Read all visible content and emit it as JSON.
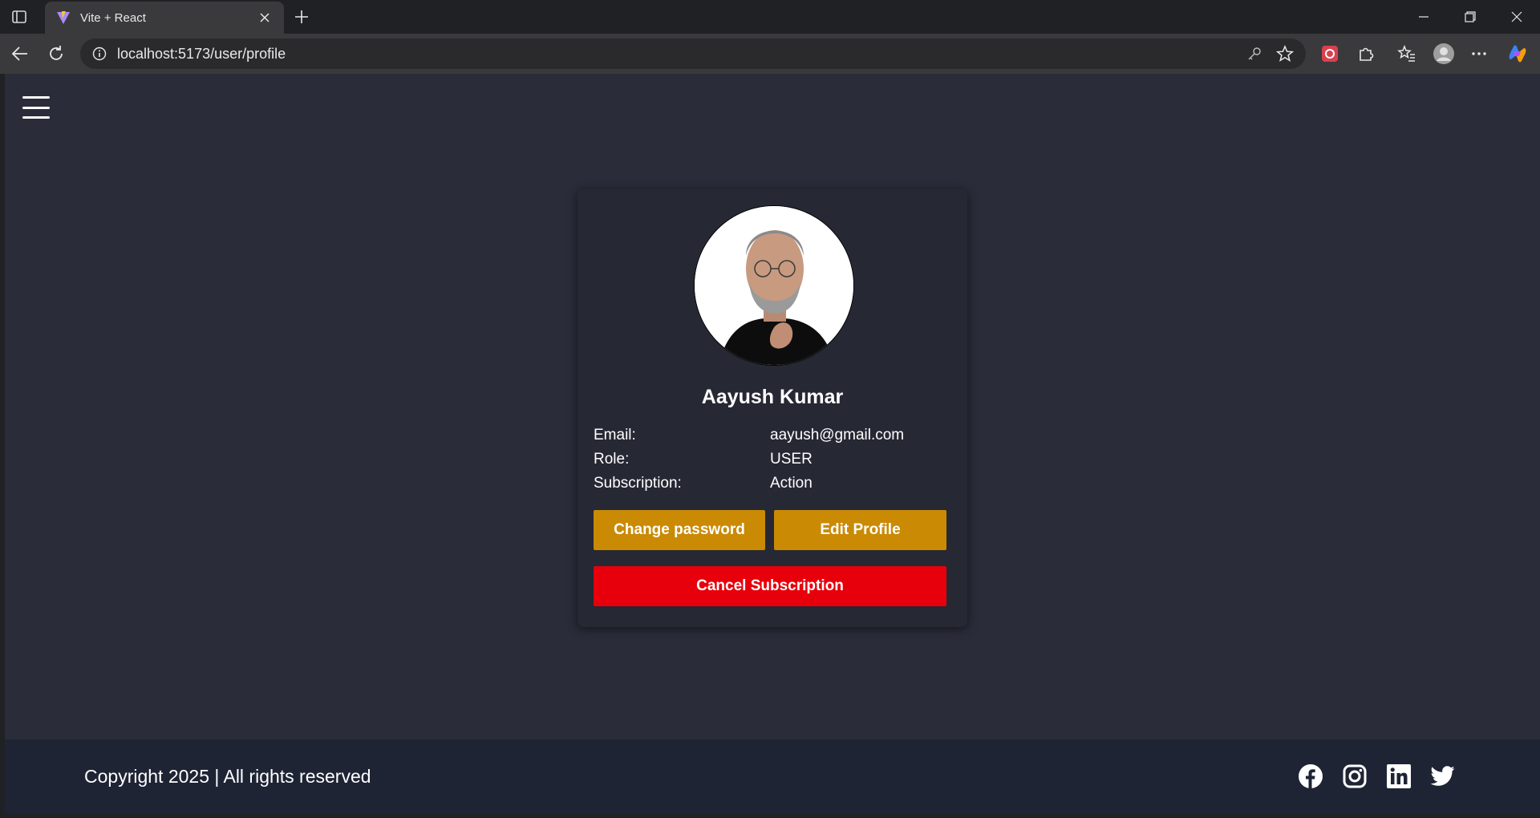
{
  "browser": {
    "tab_title": "Vite + React",
    "url": "localhost:5173/user/profile"
  },
  "profile": {
    "name": "Aayush Kumar",
    "fields": [
      {
        "label": "Email:",
        "value": "aayush@gmail.com"
      },
      {
        "label": "Role:",
        "value": "USER"
      },
      {
        "label": "Subscription:",
        "value": "Action"
      }
    ],
    "buttons": {
      "change_password": "Change password",
      "edit_profile": "Edit Profile",
      "cancel_subscription": "Cancel Subscription"
    }
  },
  "footer": {
    "copyright": "Copyright 2025 | All rights reserved",
    "social_icons": [
      "facebook-icon",
      "instagram-icon",
      "linkedin-icon",
      "twitter-icon"
    ]
  },
  "colors": {
    "page_bg": "#2a2c39",
    "card_bg": "#262834",
    "footer_bg": "#1e2434",
    "amber_button": "#ca8a04",
    "red_button": "#e7000b"
  }
}
